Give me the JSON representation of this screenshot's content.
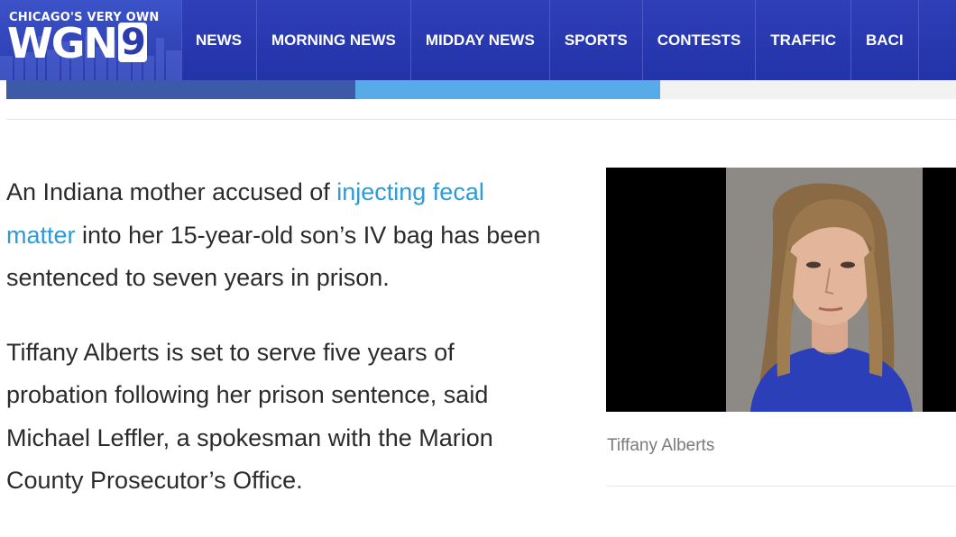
{
  "header": {
    "logo_tagline": "CHICAGO'S VERY OWN",
    "logo_word": "WGN",
    "logo_number": "9",
    "nav": [
      {
        "label": "NEWS"
      },
      {
        "label": "MORNING NEWS"
      },
      {
        "label": "MIDDAY NEWS"
      },
      {
        "label": "SPORTS"
      },
      {
        "label": "CONTESTS"
      },
      {
        "label": "TRAFFIC"
      },
      {
        "label": "BACI"
      }
    ]
  },
  "article": {
    "p1_before": "An Indiana mother accused of ",
    "p1_link": "injecting fecal matter",
    "p1_after": " into her 15-year-old son’s IV bag has been sentenced to seven years in prison.",
    "p2": "Tiffany Alberts is set to serve five years of probation following her prison sentence, said Michael Leffler, a spokesman with the Marion County Prosecutor’s Office."
  },
  "photo": {
    "caption": "Tiffany Alberts"
  },
  "colors": {
    "header_blue": "#2233a8",
    "link_blue": "#2e9bd6",
    "strip_dark": "#3d5aa8",
    "strip_light": "#56abe8"
  }
}
